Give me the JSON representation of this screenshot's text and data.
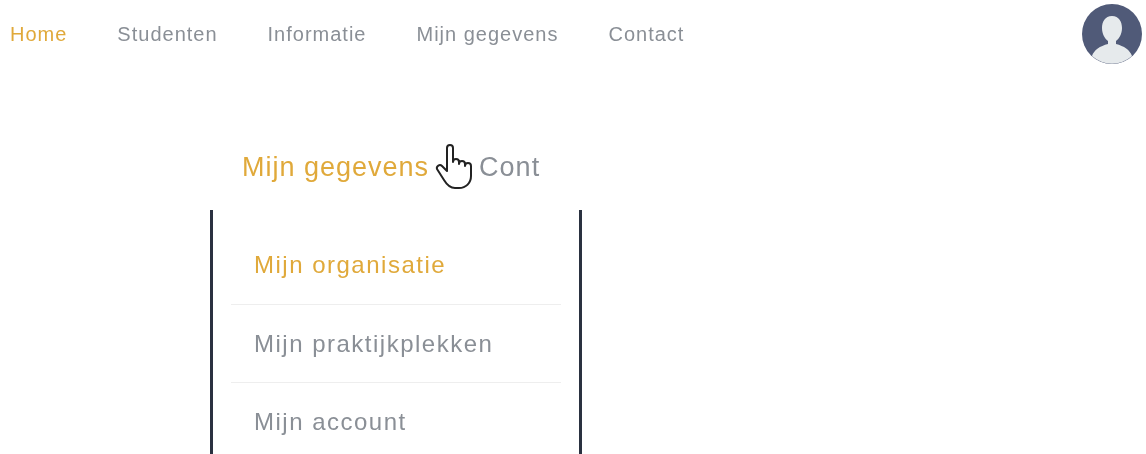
{
  "nav": {
    "items": [
      {
        "label": "Home",
        "selected": true
      },
      {
        "label": "Studenten",
        "selected": false
      },
      {
        "label": "Informatie",
        "selected": false
      },
      {
        "label": "Mijn gegevens",
        "selected": false
      },
      {
        "label": "Contact",
        "selected": false
      }
    ]
  },
  "zoom_inset": {
    "menu_items": [
      {
        "label": "Mijn gegevens",
        "selected": true
      },
      {
        "label": "Cont",
        "selected": false
      }
    ],
    "dropdown": [
      {
        "label": "Mijn organisatie",
        "selected": true
      },
      {
        "label": "Mijn praktijkplekken",
        "selected": false
      },
      {
        "label": "Mijn account",
        "selected": false
      }
    ]
  }
}
